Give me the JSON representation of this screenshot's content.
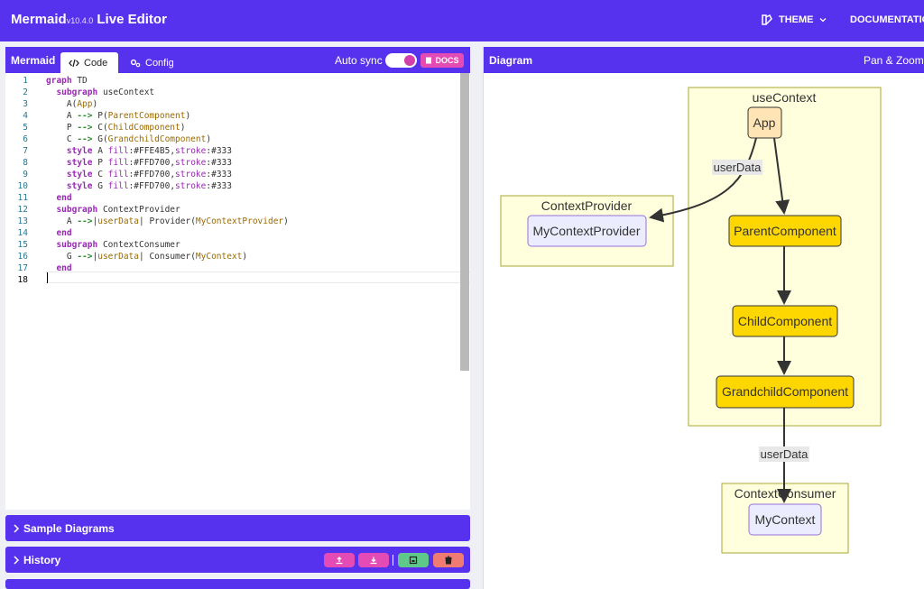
{
  "app": {
    "name": "Mermaid",
    "version": "v10.4.0",
    "title": "Live Editor"
  },
  "nav": {
    "theme_label": "THEME",
    "docs_label": "DOCUMENTATIO"
  },
  "editor_panel": {
    "title": "Mermaid",
    "tabs": [
      {
        "label": "Code",
        "icon": "code-icon",
        "active": true
      },
      {
        "label": "Config",
        "icon": "gears-icon",
        "active": false
      }
    ],
    "auto_sync_label": "Auto sync",
    "auto_sync_on": true,
    "docs_button": "DOCS",
    "line_numbers": [
      "1",
      "2",
      "3",
      "4",
      "5",
      "6",
      "7",
      "8",
      "9",
      "10",
      "11",
      "12",
      "13",
      "14",
      "15",
      "16",
      "17",
      "18"
    ],
    "code_lines": [
      "graph TD",
      "  subgraph useContext",
      "    A(App)",
      "    A --> P(ParentComponent)",
      "    P --> C(ChildComponent)",
      "    C --> G(GrandchildComponent)",
      "    style A fill:#FFE4B5,stroke:#333",
      "    style P fill:#FFD700,stroke:#333",
      "    style C fill:#FFD700,stroke:#333",
      "    style G fill:#FFD700,stroke:#333",
      "  end",
      "  subgraph ContextProvider",
      "    A -->|userData| Provider(MyContextProvider)",
      "  end",
      "  subgraph ContextConsumer",
      "    G -->|userData| Consumer(MyContext)",
      "  end",
      ""
    ]
  },
  "accordions": {
    "samples_label": "Sample Diagrams",
    "history_label": "History"
  },
  "history_buttons": [
    {
      "icon": "upload-icon",
      "color": "#e44bb4"
    },
    {
      "icon": "download-icon",
      "color": "#e44bb4"
    },
    {
      "icon": "save-icon",
      "color": "#5fc98a"
    },
    {
      "icon": "trash-icon",
      "color": "#f07b72"
    }
  ],
  "diagram_panel": {
    "title": "Diagram",
    "pan_zoom_label": "Pan & Zoom"
  },
  "diagram": {
    "subgraphs": {
      "use_context": "useContext",
      "context_provider": "ContextProvider",
      "context_consumer": "ContextConsumer"
    },
    "nodes": {
      "app": "App",
      "parent": "ParentComponent",
      "child": "ChildComponent",
      "grandchild": "GrandchildComponent",
      "provider": "MyContextProvider",
      "consumer": "MyContext"
    },
    "edge_labels": {
      "app_to_provider": "userData",
      "grandchild_to_consumer": "userData"
    },
    "colors": {
      "subgraph_fill": "#ffffde",
      "subgraph_stroke": "#aaaa33",
      "app_fill": "#FFE4B5",
      "component_fill": "#FFD700",
      "default_node_fill": "#ECECFF",
      "default_node_stroke": "#9370DB",
      "edge": "#333333",
      "edge_label_bg": "#e8e8e8"
    }
  }
}
